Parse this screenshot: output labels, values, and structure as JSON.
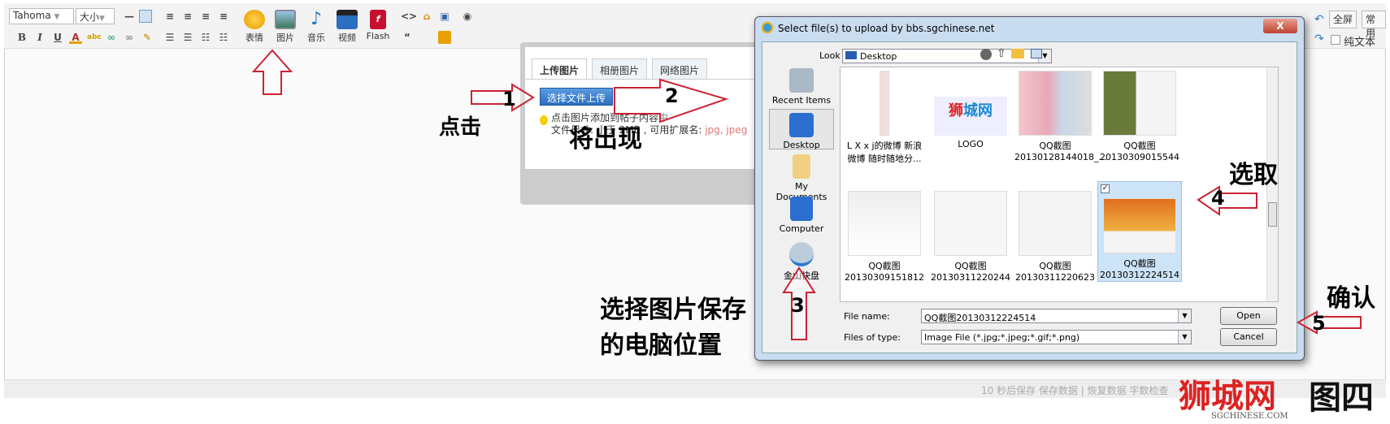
{
  "toolbar": {
    "font": "Tahoma",
    "size": "大小",
    "buttons": {
      "emoticon": "表情",
      "image": "图片",
      "music": "音乐",
      "video": "视频",
      "flash": "Flash"
    },
    "fullscreen": "全屏",
    "common": "常用",
    "plain_text": "纯文本"
  },
  "upload": {
    "tabs": [
      "上传图片",
      "相册图片",
      "网络图片"
    ],
    "choose_button": "选择文件上传",
    "hint_line1": "点击图片添加到帖子内容中",
    "hint_line2": "文件尺寸: 小于 2MB , 可用扩展名:",
    "extensions": "jpg, jpeg"
  },
  "dialog": {
    "title": "Select file(s) to upload by bbs.sgchinese.net",
    "look_in_label": "Look in:",
    "look_in_value": "Desktop",
    "sidebar": [
      "Recent Items",
      "Desktop",
      "My Documents",
      "Computer",
      "金山快盘"
    ],
    "files": [
      {
        "line1": "L X x j的微博 新浪",
        "line2": "微博 随时随地分..."
      },
      {
        "line1": "LOGO",
        "line2": ""
      },
      {
        "line1": "QQ截图",
        "line2": "20130128144018_..."
      },
      {
        "line1": "QQ截图",
        "line2": "20130309015544"
      },
      {
        "line1": "QQ截图",
        "line2": "20130309151812"
      },
      {
        "line1": "QQ截图",
        "line2": "20130311220244"
      },
      {
        "line1": "QQ截图",
        "line2": "20130311220623"
      },
      {
        "line1": "QQ截图",
        "line2": "20130312224514",
        "selected": true
      }
    ],
    "file_name_label": "File name:",
    "file_name_value": "QQ截图20130312224514",
    "file_type_label": "Files of type:",
    "file_type_value": "Image File (*.jpg;*.jpeg;*.gif;*.png)",
    "open": "Open",
    "cancel": "Cancel",
    "close": "X"
  },
  "status": "10 秒后保存 保存数据 | 恢复数据   字数检查",
  "annotations": {
    "click": "点击",
    "appear": "将出现",
    "choose_location_1": "选择图片保存",
    "choose_location_2": "的电脑位置",
    "select": "选取",
    "confirm": "确认",
    "n1": "1",
    "n2": "2",
    "n3": "3",
    "n4": "4",
    "n5": "5",
    "figure": "图四"
  },
  "watermark": {
    "logo": "狮城网",
    "site": "SGCHINESE.COM"
  },
  "colors": {
    "arrow": "#cc2233",
    "button": "#2a6fc0",
    "selected": "#cde3f7"
  }
}
